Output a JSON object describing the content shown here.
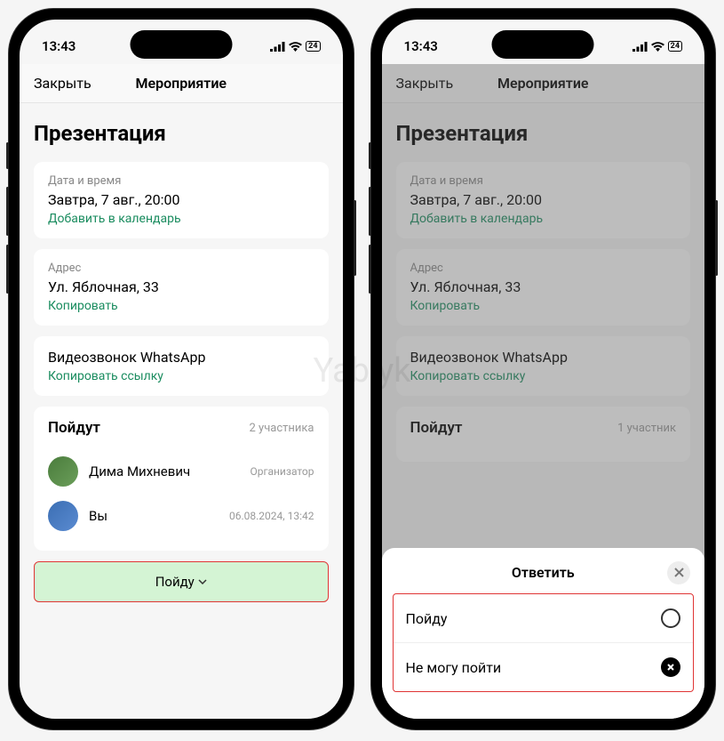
{
  "watermark": "Yablyk",
  "status": {
    "time": "13:43",
    "battery": "24"
  },
  "nav": {
    "close": "Закрыть",
    "title": "Мероприятие"
  },
  "event": {
    "title": "Презентация"
  },
  "datetime": {
    "label": "Дата и время",
    "value": "Завтра, 7 авг., 20:00",
    "action": "Добавить в календарь"
  },
  "address": {
    "label": "Адрес",
    "value": "Ул. Яблочная, 33",
    "action": "Копировать"
  },
  "call": {
    "value": "Видеозвонок WhatsApp",
    "action": "Копировать ссылку"
  },
  "going_left": {
    "title": "Пойдут",
    "count": "2 участника"
  },
  "going_right": {
    "title": "Пойдут",
    "count": "1 участник"
  },
  "participants": [
    {
      "name": "Дима Михневич",
      "meta": "Организатор"
    },
    {
      "name": "Вы",
      "meta": "06.08.2024, 13:42"
    }
  ],
  "going_button": "Пойду",
  "sheet": {
    "title": "Ответить",
    "options": [
      {
        "label": "Пойду"
      },
      {
        "label": "Не могу пойти"
      }
    ]
  }
}
